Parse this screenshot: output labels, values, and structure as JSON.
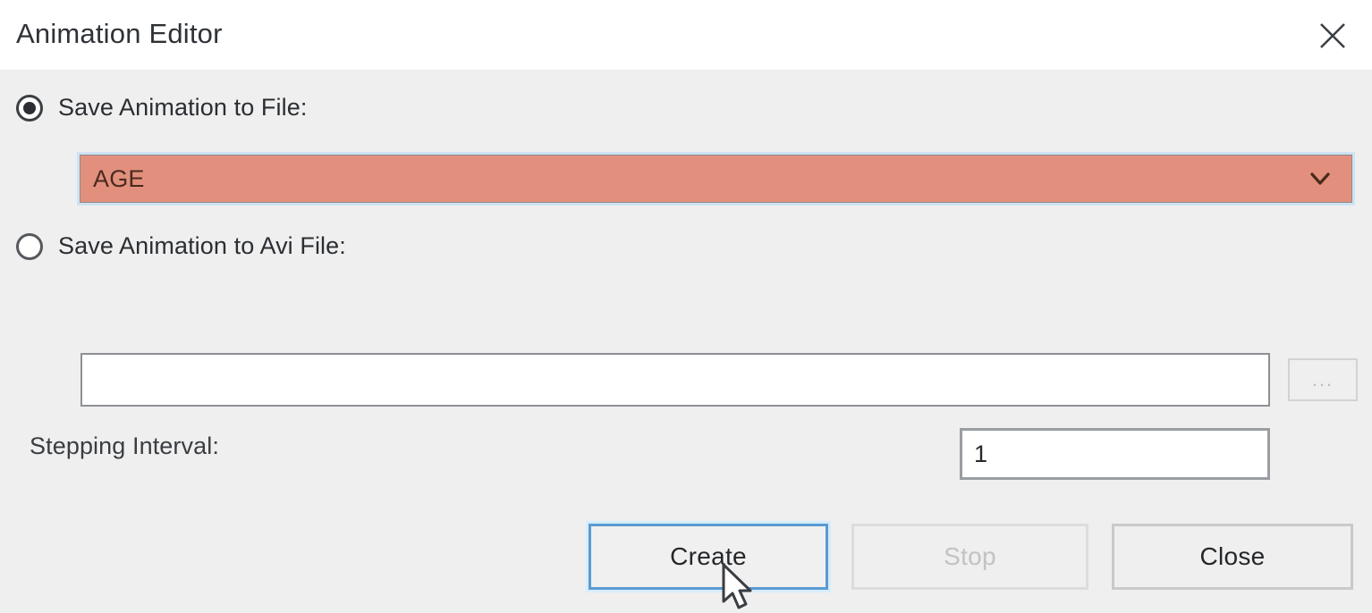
{
  "window": {
    "title": "Animation Editor",
    "close_icon": "close-x-icon"
  },
  "options": {
    "save_to_file": {
      "label": "Save Animation to File:",
      "selected": true,
      "combo_value": "AGE",
      "combo_arrow_icon": "chevron-down-icon",
      "combo_background_color": "#e2907d"
    },
    "save_to_avi": {
      "label": "Save Animation to Avi File:",
      "selected": false,
      "path_value": "",
      "browse_label": "...",
      "browse_enabled": false
    }
  },
  "stepping_interval": {
    "label": "Stepping Interval:",
    "value": "1"
  },
  "buttons": {
    "create": {
      "label": "Create",
      "enabled": true,
      "focused": true
    },
    "stop": {
      "label": "Stop",
      "enabled": false
    },
    "close": {
      "label": "Close",
      "enabled": true
    }
  },
  "pointer": {
    "icon": "mouse-arrow-cursor"
  },
  "colors": {
    "accent_focus": "#5a9bd1",
    "combo_highlight": "#e2907d",
    "dialog_background": "#efefef",
    "titlebar_background": "#ffffff"
  }
}
